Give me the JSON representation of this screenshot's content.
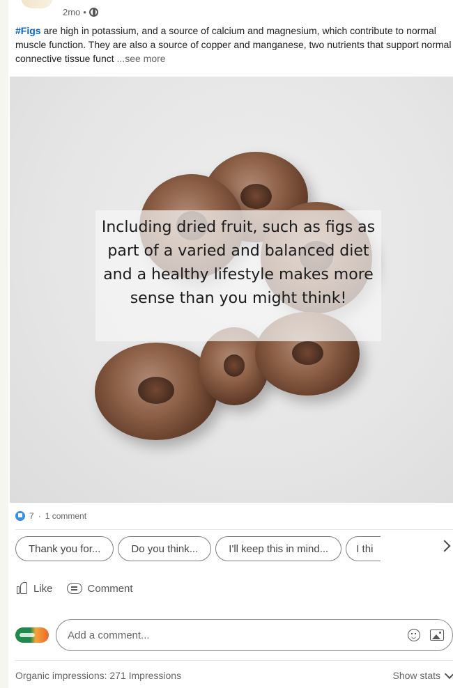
{
  "post": {
    "time": "2mo",
    "separator": "•",
    "hashtag": "#Figs",
    "body": " are high in potassium, and a source of calcium and magnesium, which contribute to normal muscle function. They are also a source of copper and manganese, two nutrients that support normal connective tissue funct",
    "see_more": "...see more",
    "image_overlay_text": "Including dried fruit, such as figs as part of a varied and balanced diet and a healthy lifestyle makes more sense than you might think!"
  },
  "social": {
    "reaction_count": "7",
    "dot": "·",
    "comment_count": "1 comment"
  },
  "suggestions": [
    "Thank you for...",
    "Do you think...",
    "I'll keep this in mind...",
    "I thi"
  ],
  "actions": {
    "like": "Like",
    "comment": "Comment"
  },
  "comment_box": {
    "placeholder": "Add a comment..."
  },
  "footer": {
    "impressions": "Organic impressions: 271 Impressions",
    "show_stats": "Show stats"
  },
  "colors": {
    "hashtag": "#0a66c2",
    "reaction": "#378fe9"
  }
}
